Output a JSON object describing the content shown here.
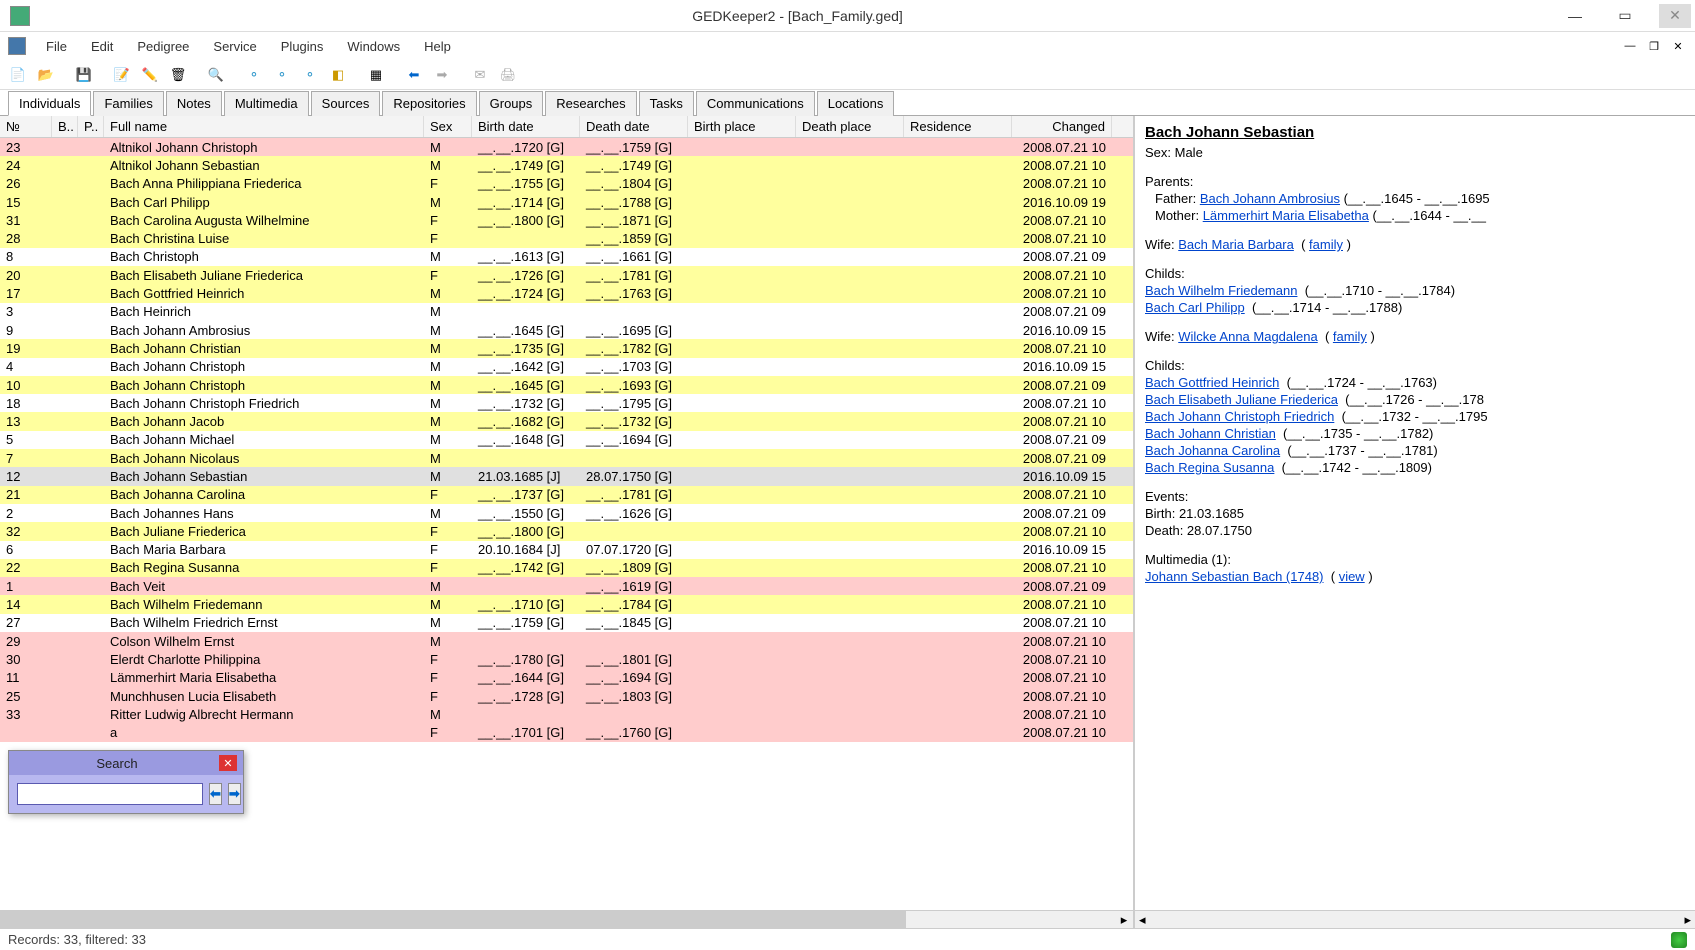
{
  "titlebar": {
    "title": "GEDKeeper2 - [Bach_Family.ged]"
  },
  "menu": {
    "file": "File",
    "edit": "Edit",
    "pedigree": "Pedigree",
    "service": "Service",
    "plugins": "Plugins",
    "windows": "Windows",
    "help": "Help"
  },
  "tabs": [
    "Individuals",
    "Families",
    "Notes",
    "Multimedia",
    "Sources",
    "Repositories",
    "Groups",
    "Researches",
    "Tasks",
    "Communications",
    "Locations"
  ],
  "columns": {
    "no": "№",
    "b": "B..",
    "p": "P..",
    "name": "Full name",
    "sex": "Sex",
    "birth": "Birth date",
    "death": "Death date",
    "bplace": "Birth place",
    "dplace": "Death place",
    "res": "Residence",
    "changed": "Changed"
  },
  "rows": [
    {
      "no": "23",
      "name": "Altnikol Johann Christoph",
      "sex": "M",
      "birth": "__.__.1720 [G]",
      "death": "__.__.1759 [G]",
      "changed": "2008.07.21 10",
      "hl": "pink"
    },
    {
      "no": "24",
      "name": "Altnikol Johann Sebastian",
      "sex": "M",
      "birth": "__.__.1749 [G]",
      "death": "__.__.1749 [G]",
      "changed": "2008.07.21 10",
      "hl": "yellow"
    },
    {
      "no": "26",
      "name": "Bach Anna Philippiana Friederica",
      "sex": "F",
      "birth": "__.__.1755 [G]",
      "death": "__.__.1804 [G]",
      "changed": "2008.07.21 10",
      "hl": "yellow"
    },
    {
      "no": "15",
      "name": "Bach Carl Philipp",
      "sex": "M",
      "birth": "__.__.1714 [G]",
      "death": "__.__.1788 [G]",
      "changed": "2016.10.09 19",
      "hl": "yellow"
    },
    {
      "no": "31",
      "name": "Bach Carolina Augusta Wilhelmine",
      "sex": "F",
      "birth": "__.__.1800 [G]",
      "death": "__.__.1871 [G]",
      "changed": "2008.07.21 10",
      "hl": "yellow"
    },
    {
      "no": "28",
      "name": "Bach Christina Luise",
      "sex": "F",
      "birth": "",
      "death": "__.__.1859 [G]",
      "changed": "2008.07.21 10",
      "hl": "yellow"
    },
    {
      "no": "8",
      "name": "Bach Christoph",
      "sex": "M",
      "birth": "__.__.1613 [G]",
      "death": "__.__.1661 [G]",
      "changed": "2008.07.21 09",
      "hl": ""
    },
    {
      "no": "20",
      "name": "Bach Elisabeth Juliane Friederica",
      "sex": "F",
      "birth": "__.__.1726 [G]",
      "death": "__.__.1781 [G]",
      "changed": "2008.07.21 10",
      "hl": "yellow"
    },
    {
      "no": "17",
      "name": "Bach Gottfried Heinrich",
      "sex": "M",
      "birth": "__.__.1724 [G]",
      "death": "__.__.1763 [G]",
      "changed": "2008.07.21 10",
      "hl": "yellow"
    },
    {
      "no": "3",
      "name": "Bach Heinrich",
      "sex": "M",
      "birth": "",
      "death": "",
      "changed": "2008.07.21 09",
      "hl": ""
    },
    {
      "no": "9",
      "name": "Bach Johann Ambrosius",
      "sex": "M",
      "birth": "__.__.1645 [G]",
      "death": "__.__.1695 [G]",
      "changed": "2016.10.09 15",
      "hl": ""
    },
    {
      "no": "19",
      "name": "Bach Johann Christian",
      "sex": "M",
      "birth": "__.__.1735 [G]",
      "death": "__.__.1782 [G]",
      "changed": "2008.07.21 10",
      "hl": "yellow"
    },
    {
      "no": "4",
      "name": "Bach Johann Christoph",
      "sex": "M",
      "birth": "__.__.1642 [G]",
      "death": "__.__.1703 [G]",
      "changed": "2016.10.09 15",
      "hl": ""
    },
    {
      "no": "10",
      "name": "Bach Johann Christoph",
      "sex": "M",
      "birth": "__.__.1645 [G]",
      "death": "__.__.1693 [G]",
      "changed": "2008.07.21 09",
      "hl": "yellow"
    },
    {
      "no": "18",
      "name": "Bach Johann Christoph Friedrich",
      "sex": "M",
      "birth": "__.__.1732 [G]",
      "death": "__.__.1795 [G]",
      "changed": "2008.07.21 10",
      "hl": ""
    },
    {
      "no": "13",
      "name": "Bach Johann Jacob",
      "sex": "M",
      "birth": "__.__.1682 [G]",
      "death": "__.__.1732 [G]",
      "changed": "2008.07.21 10",
      "hl": "yellow"
    },
    {
      "no": "5",
      "name": "Bach Johann Michael",
      "sex": "M",
      "birth": "__.__.1648 [G]",
      "death": "__.__.1694 [G]",
      "changed": "2008.07.21 09",
      "hl": ""
    },
    {
      "no": "7",
      "name": "Bach Johann Nicolaus",
      "sex": "M",
      "birth": "",
      "death": "",
      "changed": "2008.07.21 09",
      "hl": "yellow"
    },
    {
      "no": "12",
      "name": "Bach Johann Sebastian",
      "sex": "M",
      "birth": "21.03.1685 [J]",
      "death": "28.07.1750 [G]",
      "changed": "2016.10.09 15",
      "hl": "selected"
    },
    {
      "no": "21",
      "name": "Bach Johanna Carolina",
      "sex": "F",
      "birth": "__.__.1737 [G]",
      "death": "__.__.1781 [G]",
      "changed": "2008.07.21 10",
      "hl": "yellow"
    },
    {
      "no": "2",
      "name": "Bach Johannes Hans",
      "sex": "M",
      "birth": "__.__.1550 [G]",
      "death": "__.__.1626 [G]",
      "changed": "2008.07.21 09",
      "hl": ""
    },
    {
      "no": "32",
      "name": "Bach Juliane Friederica",
      "sex": "F",
      "birth": "__.__.1800 [G]",
      "death": "",
      "changed": "2008.07.21 10",
      "hl": "yellow"
    },
    {
      "no": "6",
      "name": "Bach Maria Barbara",
      "sex": "F",
      "birth": "20.10.1684 [J]",
      "death": "07.07.1720 [G]",
      "changed": "2016.10.09 15",
      "hl": ""
    },
    {
      "no": "22",
      "name": "Bach Regina Susanna",
      "sex": "F",
      "birth": "__.__.1742 [G]",
      "death": "__.__.1809 [G]",
      "changed": "2008.07.21 10",
      "hl": "yellow"
    },
    {
      "no": "1",
      "name": "Bach Veit",
      "sex": "M",
      "birth": "",
      "death": "__.__.1619 [G]",
      "changed": "2008.07.21 09",
      "hl": "pink"
    },
    {
      "no": "14",
      "name": "Bach Wilhelm Friedemann",
      "sex": "M",
      "birth": "__.__.1710 [G]",
      "death": "__.__.1784 [G]",
      "changed": "2008.07.21 10",
      "hl": "yellow"
    },
    {
      "no": "27",
      "name": "Bach Wilhelm Friedrich Ernst",
      "sex": "M",
      "birth": "__.__.1759 [G]",
      "death": "__.__.1845 [G]",
      "changed": "2008.07.21 10",
      "hl": ""
    },
    {
      "no": "29",
      "name": "Colson Wilhelm Ernst",
      "sex": "M",
      "birth": "",
      "death": "",
      "changed": "2008.07.21 10",
      "hl": "pink"
    },
    {
      "no": "30",
      "name": "Elerdt Charlotte Philippina",
      "sex": "F",
      "birth": "__.__.1780 [G]",
      "death": "__.__.1801 [G]",
      "changed": "2008.07.21 10",
      "hl": "pink"
    },
    {
      "no": "11",
      "name": "Lämmerhirt Maria Elisabetha",
      "sex": "F",
      "birth": "__.__.1644 [G]",
      "death": "__.__.1694 [G]",
      "changed": "2008.07.21 10",
      "hl": "pink"
    },
    {
      "no": "25",
      "name": "Munchhusen Lucia Elisabeth",
      "sex": "F",
      "birth": "__.__.1728 [G]",
      "death": "__.__.1803 [G]",
      "changed": "2008.07.21 10",
      "hl": "pink"
    },
    {
      "no": "33",
      "name": "Ritter Ludwig Albrecht Hermann",
      "sex": "M",
      "birth": "",
      "death": "",
      "changed": "2008.07.21 10",
      "hl": "pink"
    },
    {
      "no": "",
      "name": "a",
      "sex": "F",
      "birth": "__.__.1701 [G]",
      "death": "__.__.1760 [G]",
      "changed": "2008.07.21 10",
      "hl": "pink"
    }
  ],
  "detail": {
    "name": "Bach Johann Sebastian",
    "sex_label": "Sex: Male",
    "parents_label": "Parents:",
    "father_label": "Father:",
    "father_link": "Bach Johann Ambrosius",
    "father_dates": "(__.__.1645 - __.__.1695",
    "mother_label": "Mother:",
    "mother_link": "Lämmerhirt Maria Elisabetha",
    "mother_dates": "(__.__.1644 - __.__",
    "wife1_label": "Wife:",
    "wife1_link": "Bach Maria Barbara",
    "family_label": "family",
    "childs1_label": "Childs:",
    "childs1": [
      {
        "link": "Bach Wilhelm Friedemann",
        "dates": "(__.__.1710 - __.__.1784)"
      },
      {
        "link": "Bach Carl Philipp",
        "dates": "(__.__.1714 - __.__.1788)"
      }
    ],
    "wife2_label": "Wife:",
    "wife2_link": "Wilcke Anna Magdalena",
    "childs2_label": "Childs:",
    "childs2": [
      {
        "link": "Bach Gottfried Heinrich",
        "dates": "(__.__.1724 - __.__.1763)"
      },
      {
        "link": "Bach Elisabeth Juliane Friederica",
        "dates": "(__.__.1726 - __.__.178"
      },
      {
        "link": "Bach Johann Christoph Friedrich",
        "dates": "(__.__.1732 - __.__.1795"
      },
      {
        "link": "Bach Johann Christian",
        "dates": "(__.__.1735 - __.__.1782)"
      },
      {
        "link": "Bach Johanna Carolina",
        "dates": "(__.__.1737 - __.__.1781)"
      },
      {
        "link": "Bach Regina Susanna",
        "dates": "(__.__.1742 - __.__.1809)"
      }
    ],
    "events_label": "Events:",
    "birth_event": "Birth: 21.03.1685",
    "death_event": "Death: 28.07.1750",
    "multimedia_label": "Multimedia (1):",
    "multimedia_link": "Johann Sebastian Bach (1748)",
    "view_label": "view"
  },
  "status": {
    "records": "Records: 33, filtered: 33"
  },
  "search": {
    "title": "Search",
    "value": ""
  }
}
